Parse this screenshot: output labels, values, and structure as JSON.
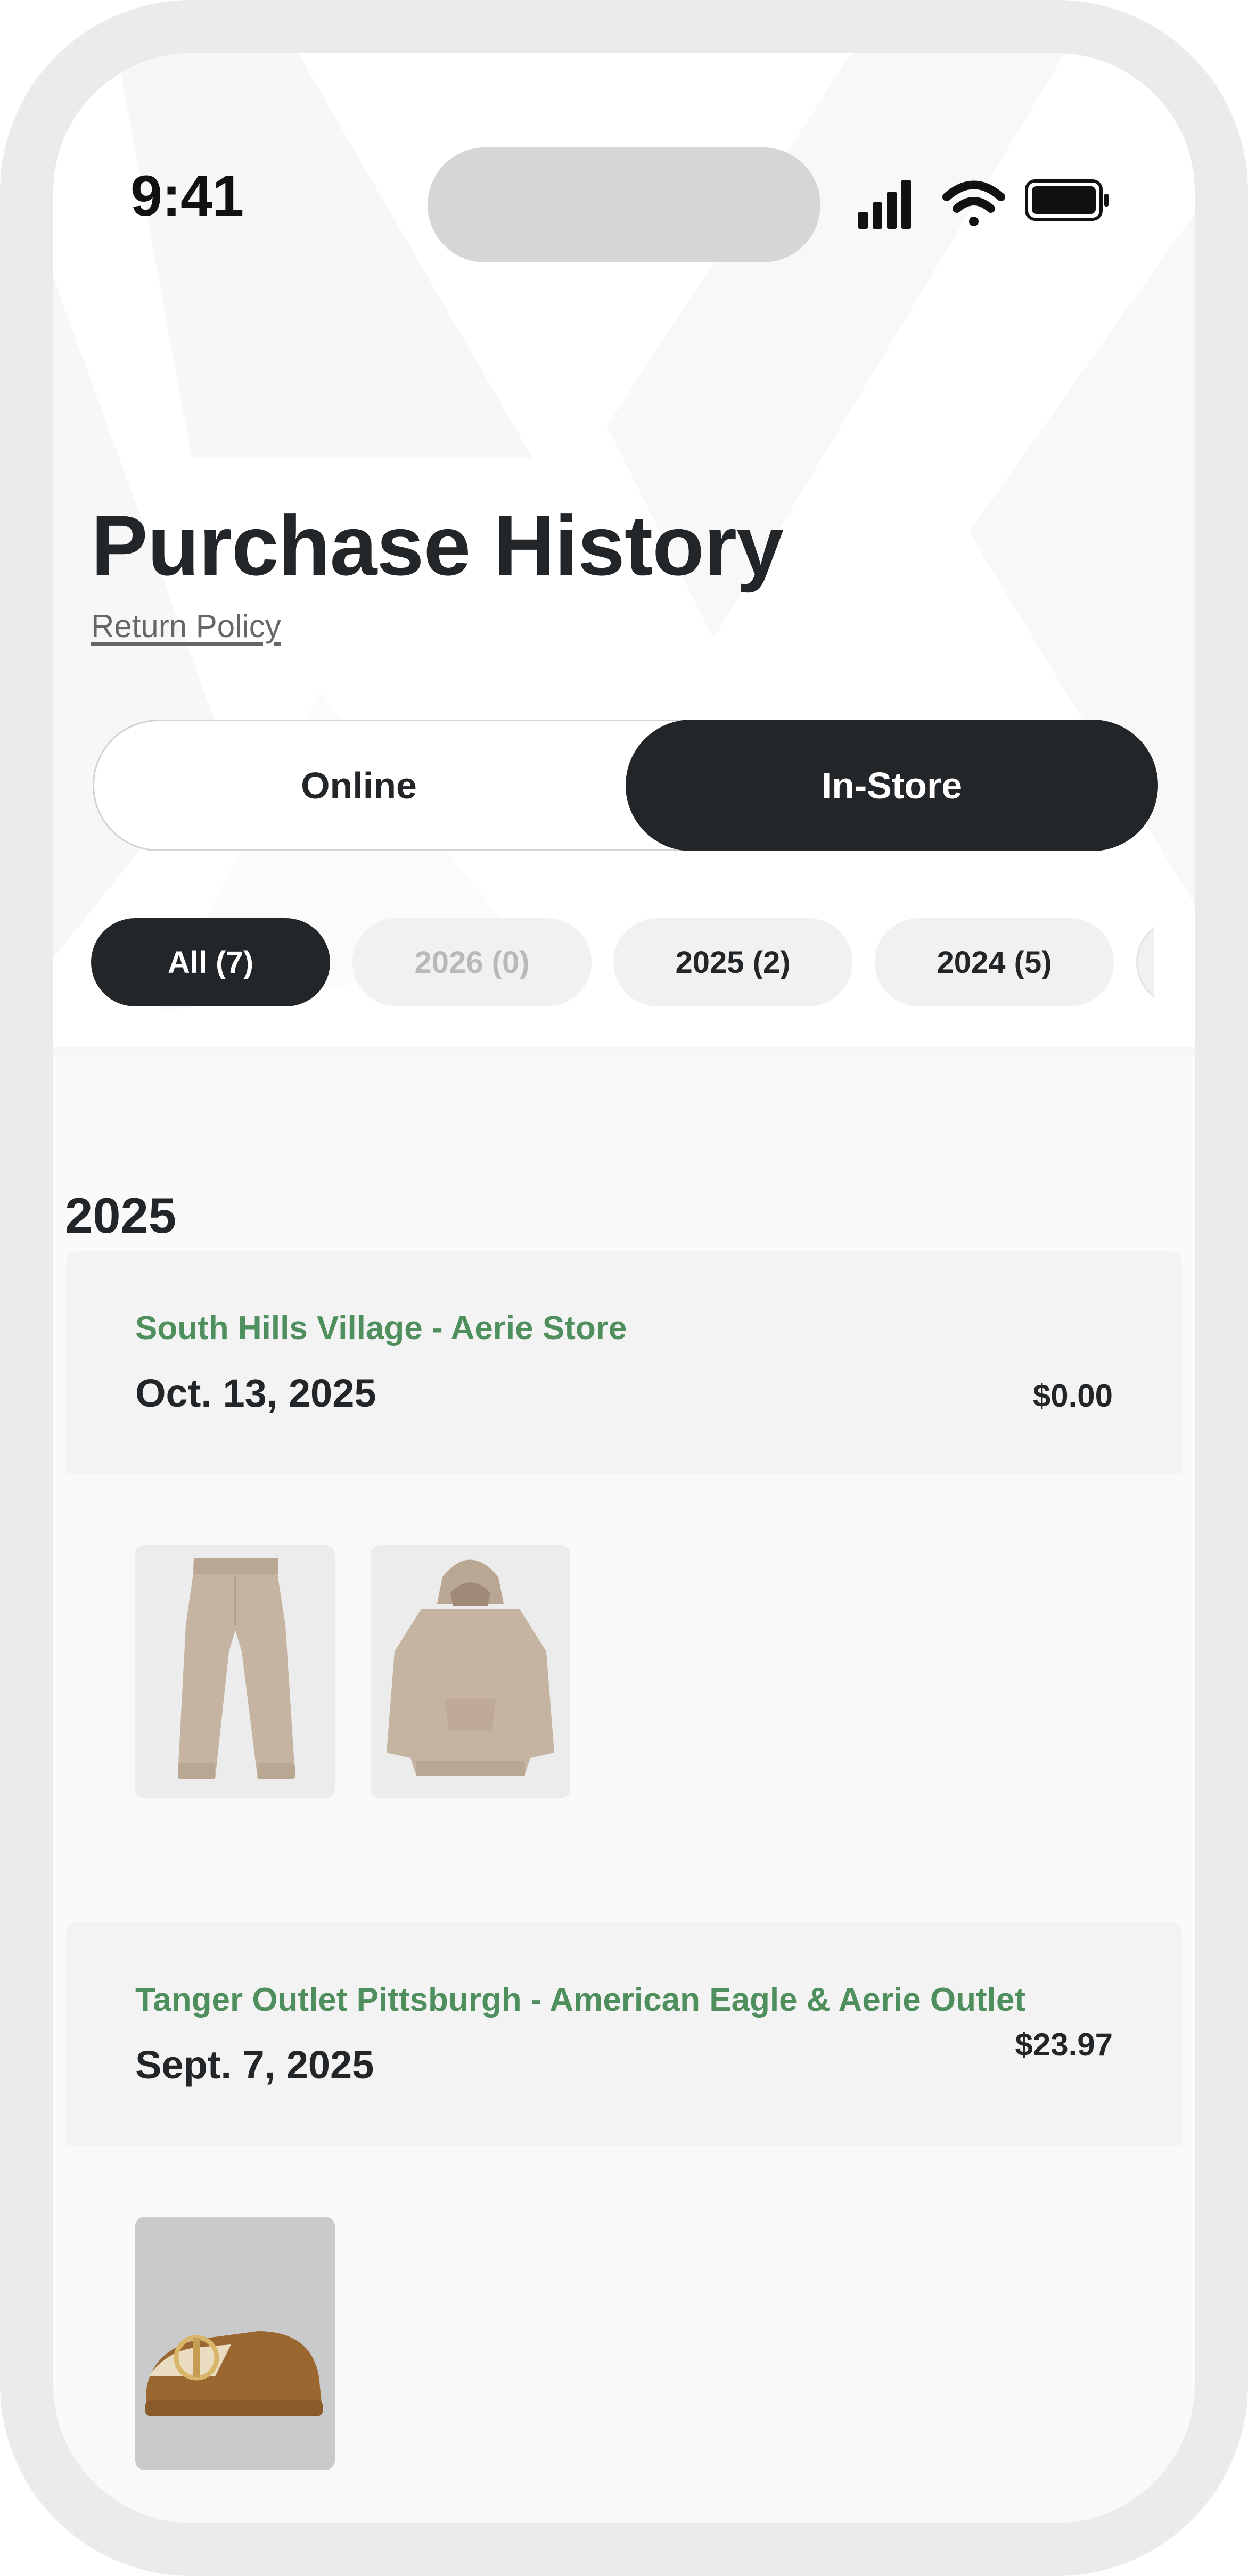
{
  "status_bar": {
    "time": "9:41",
    "icons": [
      "signal-icon",
      "wifi-icon",
      "battery-icon"
    ]
  },
  "header": {
    "title": "Purchase History",
    "return_policy": "Return Policy"
  },
  "toggle": {
    "options": [
      {
        "label": "Online",
        "selected": false
      },
      {
        "label": "In-Store",
        "selected": true
      }
    ]
  },
  "filters": [
    {
      "label": "All (7)",
      "state": "active"
    },
    {
      "label": "2026 (0)",
      "state": "disabled"
    },
    {
      "label": "2025 (2)",
      "state": "default"
    },
    {
      "label": "2024 (5)",
      "state": "default"
    }
  ],
  "section": {
    "year": "2025"
  },
  "orders": [
    {
      "store": "South Hills Village - Aerie Store",
      "date": "Oct. 13, 2025",
      "total": "$0.00",
      "items": [
        "sweatpants-image",
        "hoodie-image"
      ]
    },
    {
      "store": "Tanger Outlet Pittsburgh - American Eagle & Aerie Outlet",
      "date": "Sept. 7, 2025",
      "total": "$23.97",
      "items": [
        "clog-slipper-image"
      ]
    }
  ],
  "colors": {
    "dark": "#232629",
    "store_green": "#4f8f5d",
    "chip_bg": "#f1f1f1",
    "frame": "#ebebeb"
  }
}
